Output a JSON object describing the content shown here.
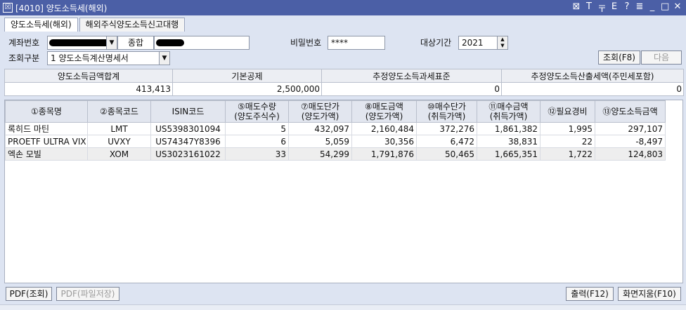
{
  "window": {
    "app_glyph": "☒",
    "title": "[4010] 양도소득세(해외)",
    "controls": [
      "⊠",
      "T",
      "〒",
      "ⴹ",
      "?",
      "≣",
      "_",
      "□",
      "✕"
    ]
  },
  "tabs": [
    {
      "label": "양도소득세(해외)",
      "active": true
    },
    {
      "label": "해외주식양도소득신고대행",
      "active": false
    }
  ],
  "form": {
    "account_label": "계좌번호",
    "account_type": "종합",
    "password_label": "비밀번호",
    "password_value": "****",
    "period_label": "대상기간",
    "period_value": "2021",
    "query_type_label": "조회구분",
    "query_type_value": "1 양도소득계산명세서",
    "query_button": "조회(F8)",
    "next_button": "다음"
  },
  "summary": {
    "headers": [
      "양도소득금액합계",
      "기본공제",
      "추정양도소득과세표준",
      "추정양도소득산출세액(주민세포함)"
    ],
    "values": [
      "413,413",
      "2,500,000",
      "0",
      "0"
    ]
  },
  "grid": {
    "headers": [
      [
        "①종목명",
        ""
      ],
      [
        "②종목코드",
        ""
      ],
      [
        "ISIN코드",
        ""
      ],
      [
        "⑤매도수량",
        "(양도주식수)"
      ],
      [
        "⑦매도단가",
        "(양도가액)"
      ],
      [
        "⑧매도금액",
        "(양도가액)"
      ],
      [
        "⑩매수단가",
        "(취득가액)"
      ],
      [
        "⑪매수금액",
        "(취득가액)"
      ],
      [
        "⑫필요경비",
        ""
      ],
      [
        "⑬양도소득금액",
        ""
      ]
    ],
    "rows": [
      [
        "록히드 마틴",
        "LMT",
        "US5398301094",
        "5",
        "432,097",
        "2,160,484",
        "372,276",
        "1,861,382",
        "1,995",
        "297,107"
      ],
      [
        "PROETF ULTRA VIX S",
        "UVXY",
        "US74347Y8396",
        "6",
        "5,059",
        "30,356",
        "6,472",
        "38,831",
        "22",
        "-8,497"
      ],
      [
        "엑손 모빌",
        "XOM",
        "US3023161022",
        "33",
        "54,299",
        "1,791,876",
        "50,465",
        "1,665,351",
        "1,722",
        "124,803"
      ]
    ]
  },
  "footer": {
    "pdf_view": "PDF(조회)",
    "pdf_save": "PDF(파일저장)",
    "print": "출력(F12)",
    "clear": "화면지움(F10)"
  }
}
